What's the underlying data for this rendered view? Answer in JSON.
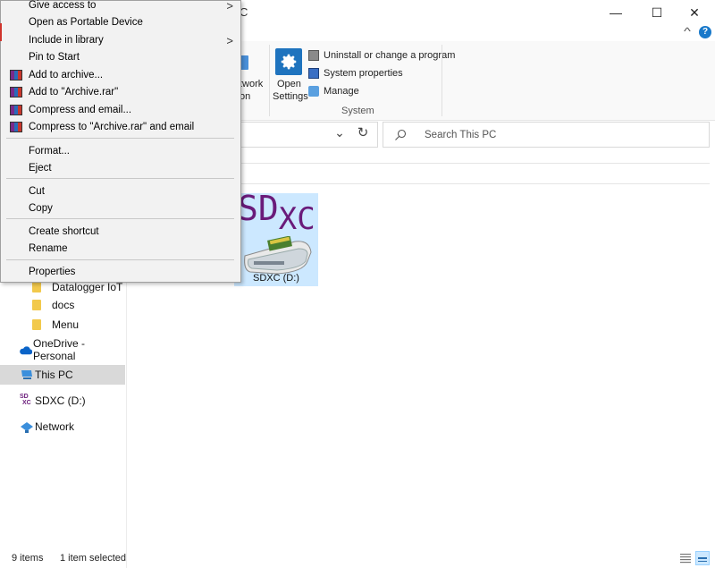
{
  "window": {
    "title_fragment": "C",
    "minimize": "—",
    "maximize": "☐",
    "close": "✕",
    "ribbon_collapse": "^",
    "help": "?"
  },
  "ribbon": {
    "network_label_line1": "twork",
    "network_label_line2": "on",
    "open_settings_line1": "Open",
    "open_settings_line2": "Settings",
    "uninstall": "Uninstall or change a program",
    "system_properties": "System properties",
    "manage": "Manage",
    "group_system": "System"
  },
  "address": {
    "search_placeholder": "Search This PC",
    "dropdown": "⌄",
    "refresh": "↻"
  },
  "context_menu": {
    "items": [
      {
        "label": "Give access to",
        "submenu": ">"
      },
      {
        "label": "Open as Portable Device"
      },
      {
        "label": "Include in library",
        "submenu": ">"
      },
      {
        "label": "Pin to Start"
      },
      {
        "label": "Add to archive..."
      },
      {
        "label": "Add to \"Archive.rar\""
      },
      {
        "label": "Compress and email..."
      },
      {
        "label": "Compress to \"Archive.rar\" and email"
      },
      {
        "label": "Format..."
      },
      {
        "label": "Eject"
      },
      {
        "label": "Cut"
      },
      {
        "label": "Copy"
      },
      {
        "label": "Create shortcut"
      },
      {
        "label": "Rename"
      },
      {
        "label": "Properties"
      }
    ]
  },
  "nav": {
    "items": [
      {
        "label": "Datalogger IoT"
      },
      {
        "label": "docs"
      },
      {
        "label": "Menu"
      },
      {
        "label": "OneDrive - Personal"
      },
      {
        "label": "This PC"
      },
      {
        "label": "SDXC (D:)"
      },
      {
        "label": "Network"
      }
    ]
  },
  "content": {
    "drive_label": "SDXC (D:)",
    "drive_logo_sd": "SD",
    "drive_logo_xc": "XC",
    "sd_icon_small_top": "SD",
    "sd_icon_small_bottom": "XC"
  },
  "status": {
    "items_count": "9 items",
    "selected": "1 item selected"
  },
  "colors": {
    "accent": "#0078d7",
    "selection": "#cce8ff",
    "nav_selected": "#d9d9d9",
    "sdxc_purple": "#6a1b7a"
  }
}
